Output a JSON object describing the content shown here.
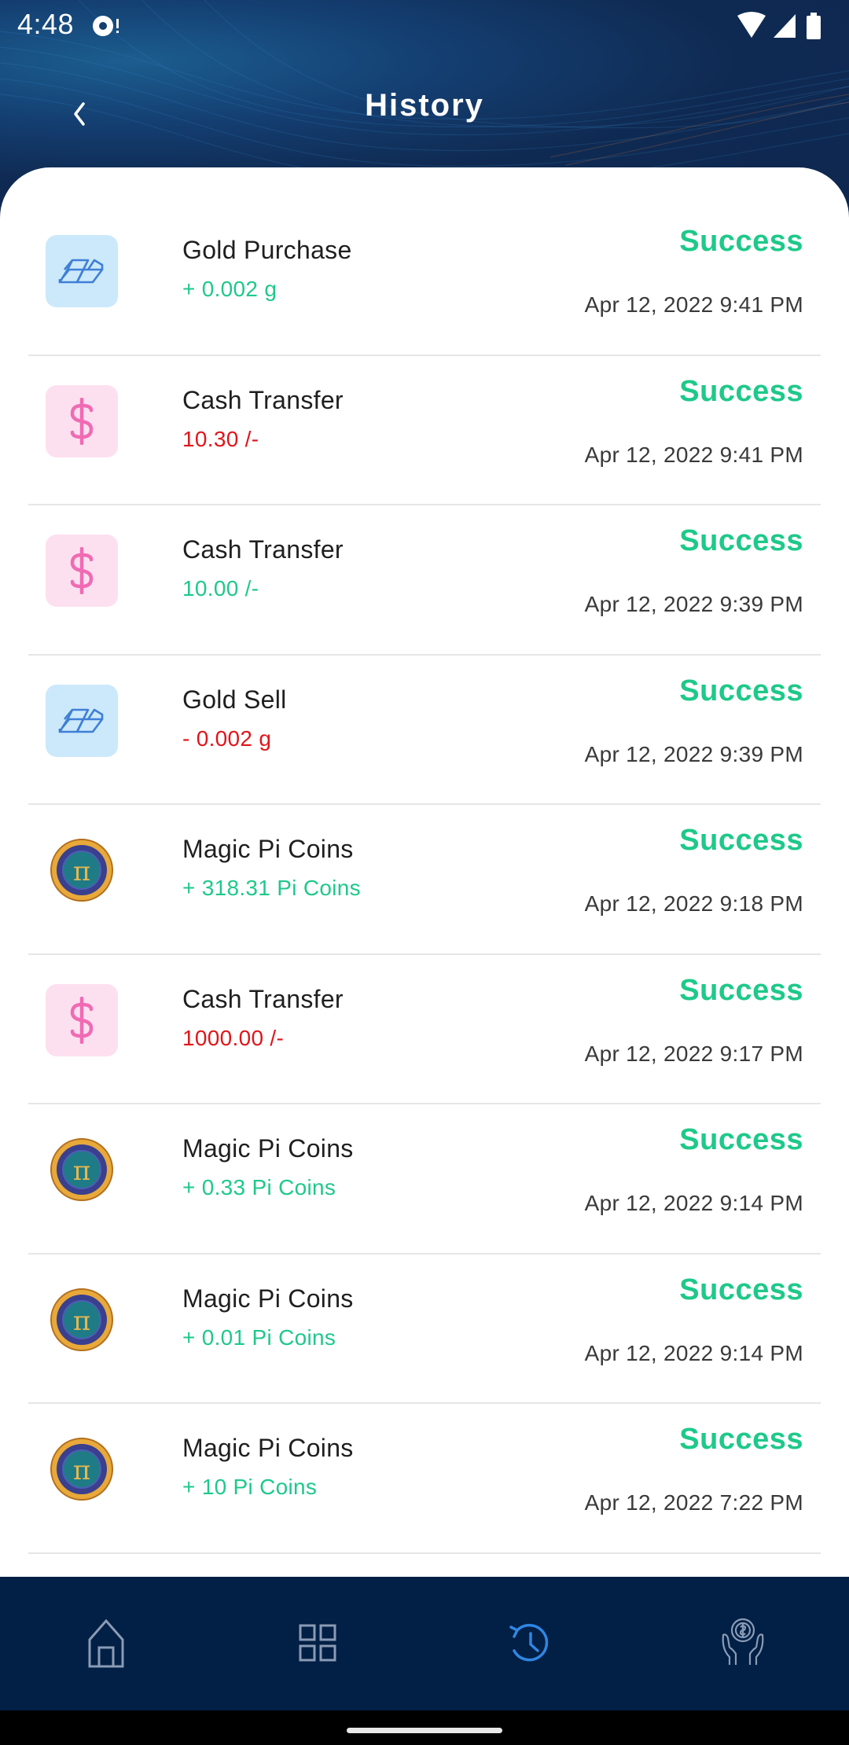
{
  "status_bar": {
    "time": "4:48",
    "icons": [
      "notification-icon",
      "wifi-icon",
      "signal-icon",
      "battery-icon"
    ]
  },
  "header": {
    "title": "History",
    "back_icon": "chevron-left-icon"
  },
  "colors": {
    "header_bg": "#0f2a52",
    "success": "#1ec98a",
    "positive_amount": "#1ec98a",
    "negative_amount": "#e0151b",
    "nav_bg": "#021f45",
    "nav_active": "#2f86e3",
    "nav_inactive": "#8a9bb5"
  },
  "transactions": [
    {
      "type": "gold",
      "icon": "gold-bars-icon",
      "title": "Gold Purchase",
      "amount": "+ 0.002 g",
      "amount_sign": "pos",
      "status": "Success",
      "date": "Apr 12, 2022 9:41 PM"
    },
    {
      "type": "cash",
      "icon": "dollar-icon",
      "title": "Cash Transfer",
      "amount": "10.30 /-",
      "amount_sign": "neg",
      "status": "Success",
      "date": "Apr 12, 2022 9:41 PM"
    },
    {
      "type": "cash",
      "icon": "dollar-icon",
      "title": "Cash Transfer",
      "amount": "10.00 /-",
      "amount_sign": "pos",
      "status": "Success",
      "date": "Apr 12, 2022 9:39 PM"
    },
    {
      "type": "gold",
      "icon": "gold-bars-icon",
      "title": "Gold Sell",
      "amount": "- 0.002 g",
      "amount_sign": "neg",
      "status": "Success",
      "date": "Apr 12, 2022 9:39 PM"
    },
    {
      "type": "pi",
      "icon": "pi-coin-icon",
      "title": "Magic Pi Coins",
      "amount": "+ 318.31 Pi Coins",
      "amount_sign": "pos",
      "status": "Success",
      "date": "Apr 12, 2022 9:18 PM"
    },
    {
      "type": "cash",
      "icon": "dollar-icon",
      "title": "Cash Transfer",
      "amount": "1000.00 /-",
      "amount_sign": "neg",
      "status": "Success",
      "date": "Apr 12, 2022 9:17 PM"
    },
    {
      "type": "pi",
      "icon": "pi-coin-icon",
      "title": "Magic Pi Coins",
      "amount": "+ 0.33 Pi Coins",
      "amount_sign": "pos",
      "status": "Success",
      "date": "Apr 12, 2022 9:14 PM"
    },
    {
      "type": "pi",
      "icon": "pi-coin-icon",
      "title": "Magic Pi Coins",
      "amount": "+ 0.01 Pi Coins",
      "amount_sign": "pos",
      "status": "Success",
      "date": "Apr 12, 2022 9:14 PM"
    },
    {
      "type": "pi",
      "icon": "pi-coin-icon",
      "title": "Magic Pi Coins",
      "amount": "+ 10 Pi Coins",
      "amount_sign": "pos",
      "status": "Success",
      "date": "Apr 12, 2022 7:22 PM"
    }
  ],
  "bottom_nav": {
    "items": [
      {
        "icon": "home-icon",
        "active": false
      },
      {
        "icon": "grid-icon",
        "active": false
      },
      {
        "icon": "history-icon",
        "active": true
      },
      {
        "icon": "hands-coin-icon",
        "active": false
      }
    ]
  }
}
